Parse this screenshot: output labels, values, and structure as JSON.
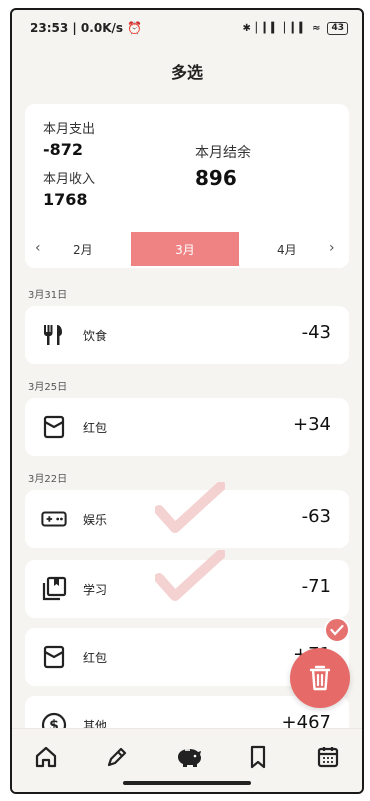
{
  "status_bar": {
    "time_speed": "23:53 | 0.0K/s",
    "battery": "43"
  },
  "header": {
    "title": "多选"
  },
  "summary": {
    "expense_label": "本月支出",
    "expense_value": "-872",
    "income_label": "本月收入",
    "income_value": "1768",
    "balance_label": "本月结余",
    "balance_value": "896"
  },
  "month_selector": {
    "prev_arrow": "‹",
    "prev": "2月",
    "current": "3月",
    "next": "4月",
    "next_arrow": "›"
  },
  "groups": [
    {
      "date": "3月31日",
      "records": [
        {
          "icon": "fork-knife-icon",
          "category": "饮食",
          "amount": "-43"
        }
      ]
    },
    {
      "date": "3月25日",
      "records": [
        {
          "icon": "red-envelope-icon",
          "category": "红包",
          "amount": "+34"
        }
      ]
    },
    {
      "date": "3月22日",
      "records": [
        {
          "icon": "gamepad-icon",
          "category": "娱乐",
          "amount": "-63",
          "selected": true
        },
        {
          "icon": "books-icon",
          "category": "学习",
          "amount": "-71",
          "selected": true
        },
        {
          "icon": "red-envelope-icon",
          "category": "红包",
          "amount": "+71"
        },
        {
          "icon": "dollar-coin-icon",
          "category": "其他",
          "amount": "+467"
        }
      ]
    }
  ],
  "colors": {
    "accent": "#ef8383",
    "delete": "#e66b68",
    "background": "#f6f4f1",
    "card": "#ffffff"
  },
  "bottom_nav": [
    "home-icon",
    "pen-icon",
    "piggy-bank-icon",
    "bookmark-icon",
    "calendar-icon"
  ]
}
